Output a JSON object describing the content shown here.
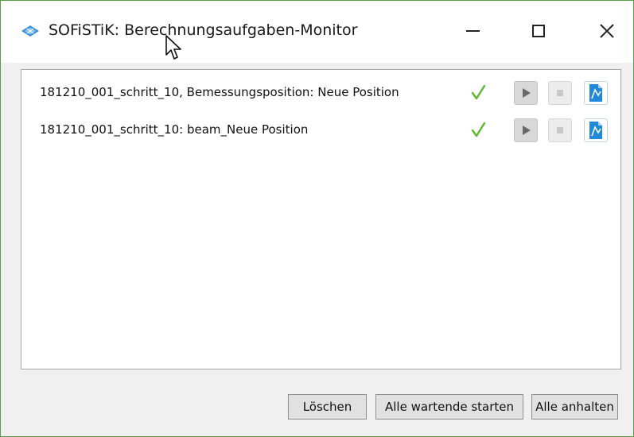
{
  "window": {
    "title": "SOFiSTiK: Berechnungsaufgaben-Monitor",
    "accent_color": "#5a9e47",
    "controls": {
      "minimize_icon": "minimize-icon",
      "maximize_icon": "maximize-icon",
      "close_icon": "close-icon"
    }
  },
  "tasks": [
    {
      "name": "181210_001_schritt_10, Bemessungsposition: Neue Position",
      "status": "completed",
      "status_icon": "checkmark-icon",
      "actions": [
        "play-icon",
        "stop-icon",
        "report-icon"
      ]
    },
    {
      "name": "181210_001_schritt_10: beam_Neue Position",
      "status": "completed",
      "status_icon": "checkmark-icon",
      "actions": [
        "play-icon",
        "stop-icon",
        "report-icon"
      ]
    }
  ],
  "footer": {
    "delete_label": "Löschen",
    "start_all_label": "Alle wartende starten",
    "stop_all_label": "Alle anhalten"
  },
  "colors": {
    "check": "#5cb82e",
    "report_icon": "#1f8ad9"
  }
}
